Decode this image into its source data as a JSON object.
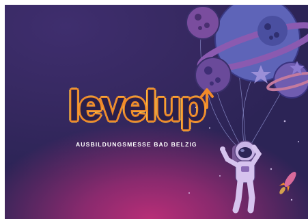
{
  "poster": {
    "logo_text": "levelup",
    "subtitle": "AUSBILDUNGSMESSE BAD BELZIG"
  },
  "colors": {
    "background_top": "#2c2456",
    "background_glow": "#b82e77",
    "logo_outline": "#f08a2a",
    "logo_highlight": "#f7c14a",
    "balloon_blue": "#6b6fc4",
    "balloon_purple": "#8a5aa8"
  },
  "icons": [
    "planet-balloon-icon",
    "star-icon",
    "astronaut-icon",
    "rocket-icon",
    "arrow-up-icon"
  ]
}
